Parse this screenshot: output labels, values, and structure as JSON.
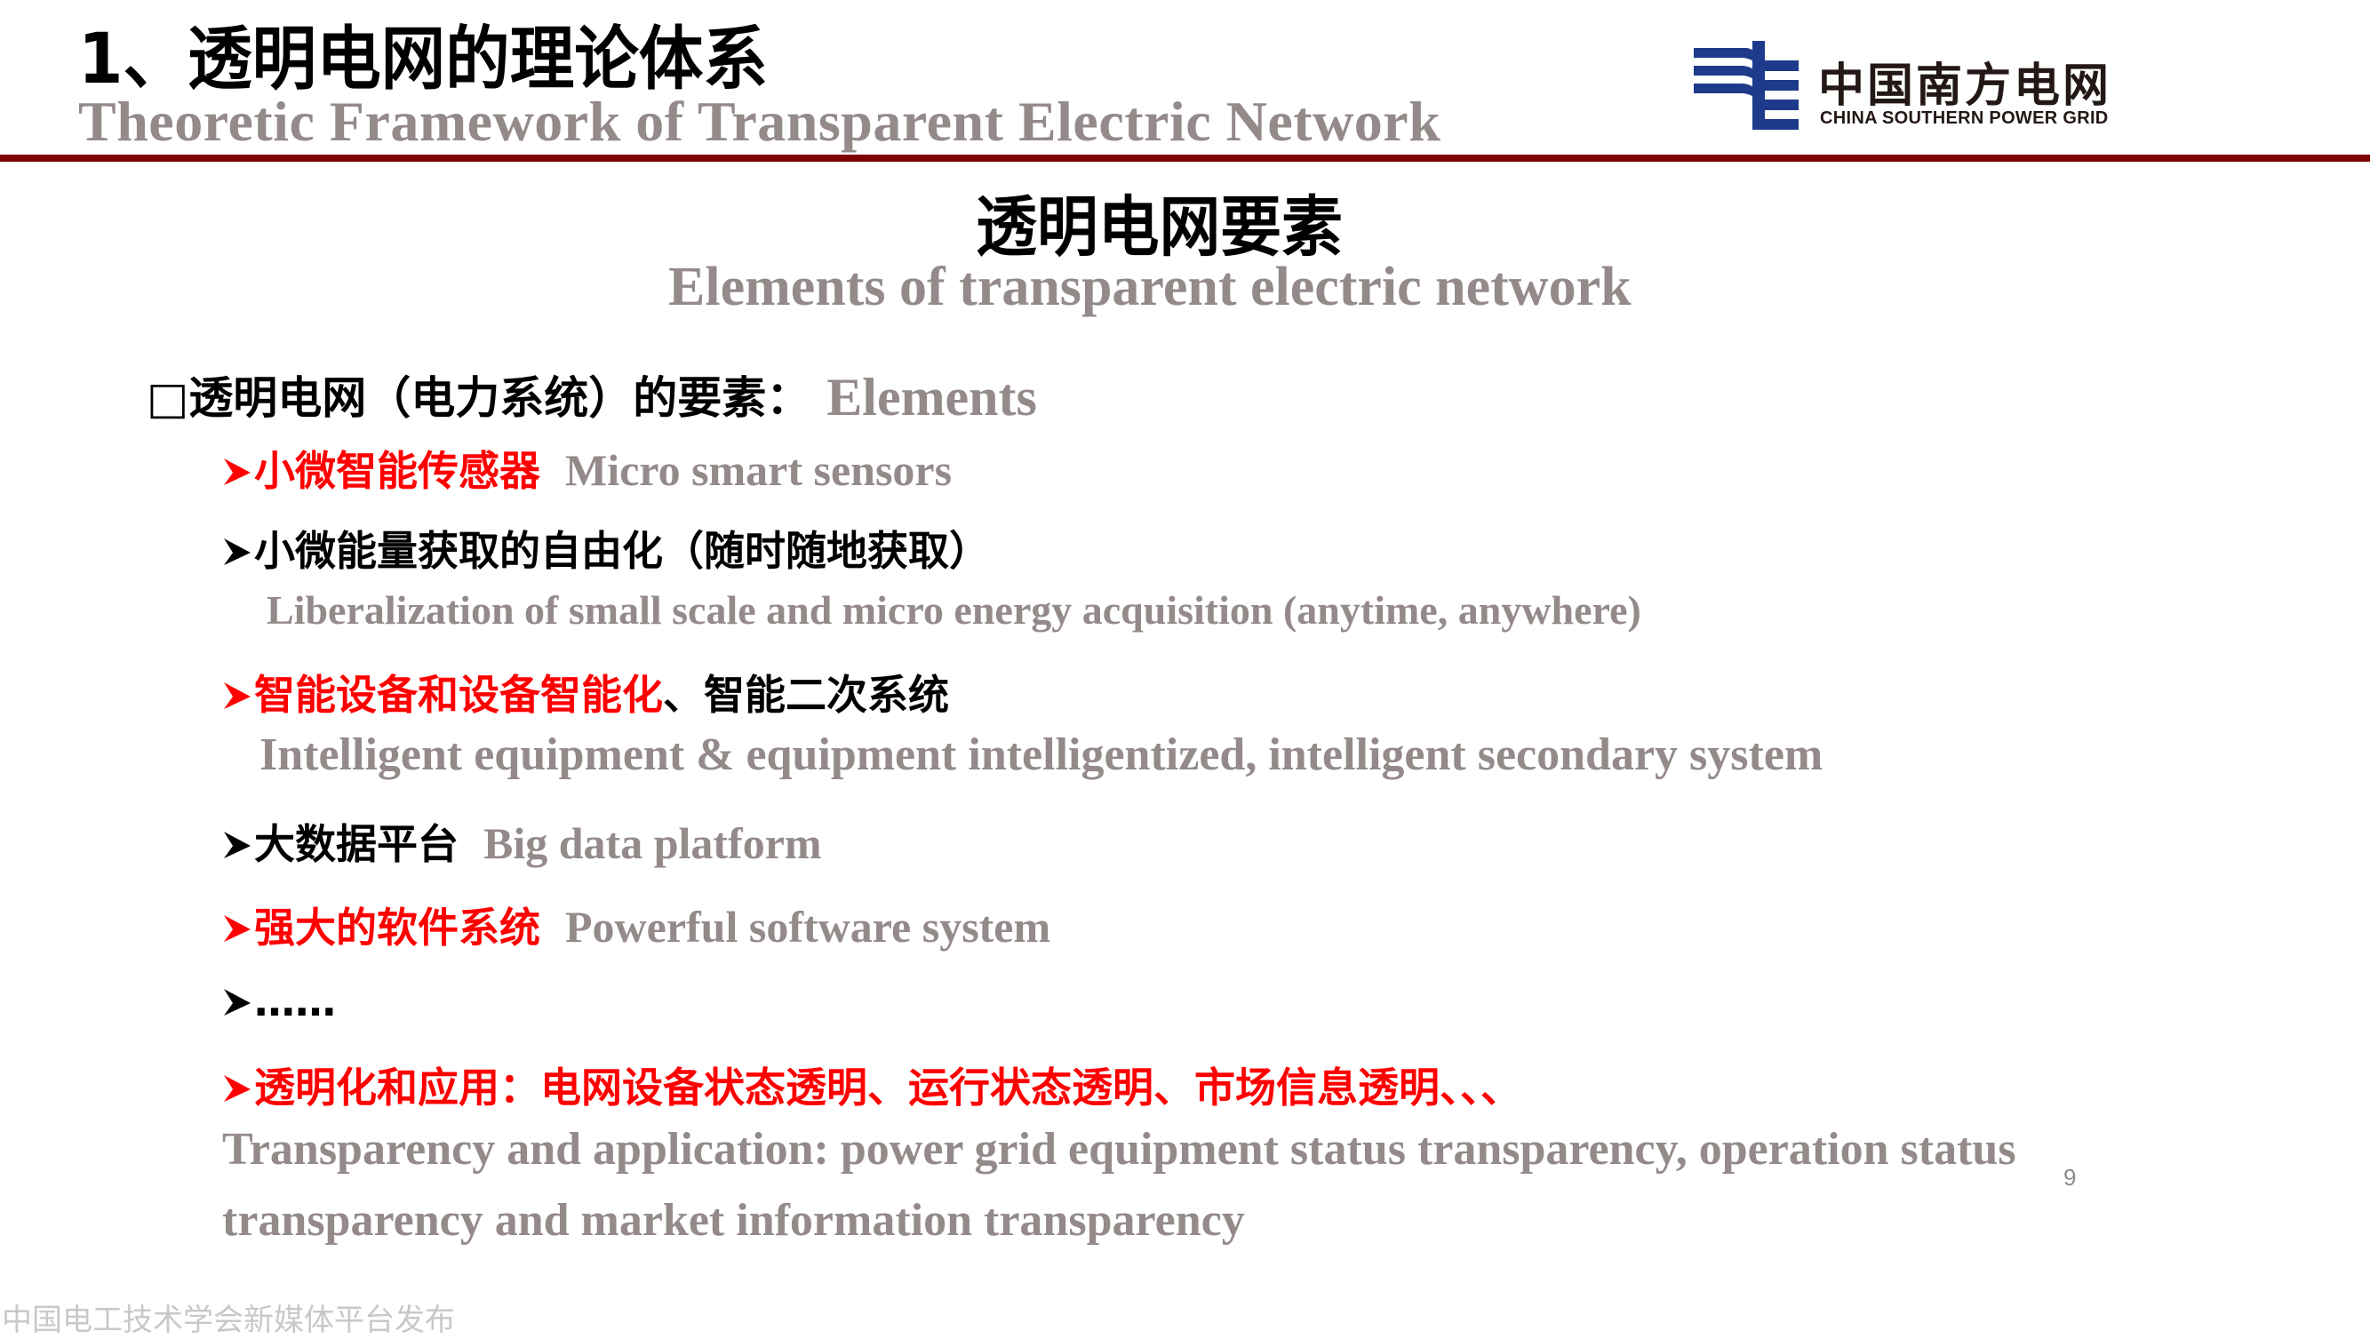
{
  "header": {
    "title": "1、透明电网的理论体系",
    "subtitle": "Theoretic Framework of Transparent Electric Network",
    "rule_color": "#7f0000"
  },
  "logo": {
    "name_cn": "中国南方电网",
    "name_en": "CHINA SOUTHERN POWER GRID",
    "mark_color": "#1e3a8a",
    "icon": "china-southern-power-grid-logo"
  },
  "section": {
    "heading": "透明电网要素",
    "heading_en": "Elements of transparent electric network"
  },
  "elements": {
    "lead_bullet": "□",
    "lead_cn": "透明电网（电力系统）的要素：",
    "lead_en": "Elements",
    "items": [
      {
        "cn": "小微智能传感器",
        "en": "Micro smart sensors",
        "color": "red"
      },
      {
        "cn": "小微能量获取的自由化（随时随地获取）",
        "en": "Liberalization of small scale and micro energy acquisition (anytime, anywhere)",
        "color": "black"
      },
      {
        "cn": "智能设备和设备智能化",
        "cn_tail": "、智能二次系统",
        "en": "Intelligent equipment & equipment intelligentized, intelligent secondary system",
        "color": "red"
      },
      {
        "cn": "大数据平台",
        "en": "Big data platform",
        "color": "black"
      },
      {
        "cn": "强大的软件系统",
        "en": "Powerful software system",
        "color": "red"
      },
      {
        "cn": "……",
        "color": "black"
      },
      {
        "cn": "透明化和应用：电网设备状态透明、运行状态透明、市场信息透明、、、",
        "en_line1": "Transparency and application: power grid equipment status transparency, operation status",
        "en_line2": "transparency and market information transparency",
        "color": "red"
      }
    ],
    "colors": {
      "red": "#ff0000",
      "black": "#000000",
      "gray": "#948a8a"
    }
  },
  "footer": {
    "page_number": "9",
    "watermark": "中国电工技术学会新媒体平台发布"
  }
}
